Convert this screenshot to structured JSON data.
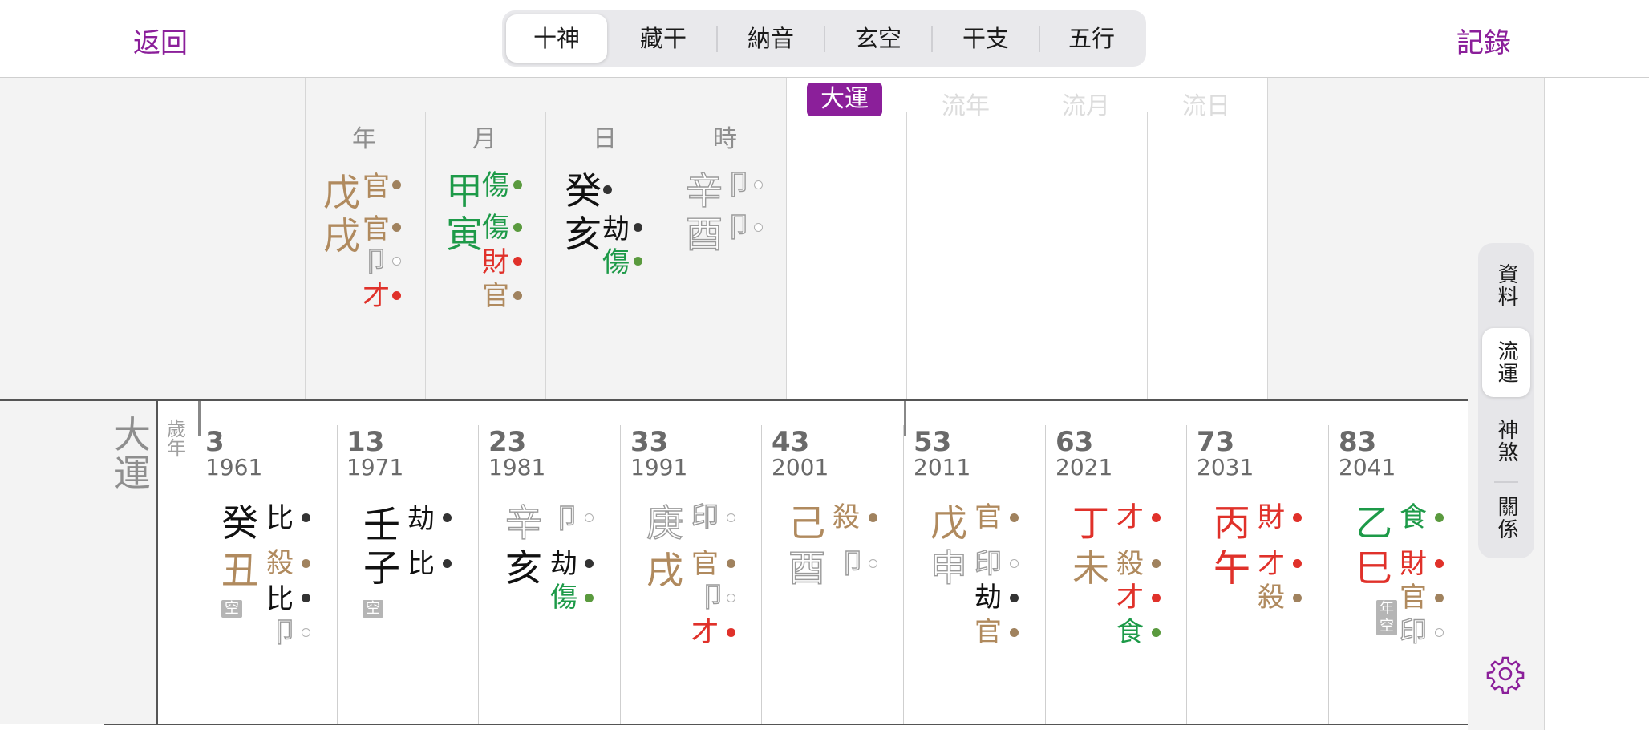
{
  "nav": {
    "back_label": "返回",
    "record_label": "記錄"
  },
  "tabs": [
    {
      "label": "十神",
      "selected": true
    },
    {
      "label": "藏干"
    },
    {
      "label": "納音"
    },
    {
      "label": "玄空"
    },
    {
      "label": "干支"
    },
    {
      "label": "五行"
    }
  ],
  "pillar_headers": [
    "年",
    "月",
    "日",
    "時"
  ],
  "luck_headers": [
    "大運",
    "流年",
    "流月",
    "流日"
  ],
  "side_tabs": [
    {
      "label": "資料"
    },
    {
      "label": "流運",
      "selected": true
    },
    {
      "label": "神煞"
    },
    {
      "label": "關係"
    }
  ],
  "dayun": {
    "label": "大運",
    "age_label": "歲年"
  },
  "colors": {
    "accent": "#8b1f9a",
    "earth": "#b08a5e",
    "wood": "#1d9a48",
    "fire": "#e0312a",
    "black": "#111111",
    "gray": "#9a9a9a"
  },
  "icons": {
    "settings": "gear-icon"
  }
}
